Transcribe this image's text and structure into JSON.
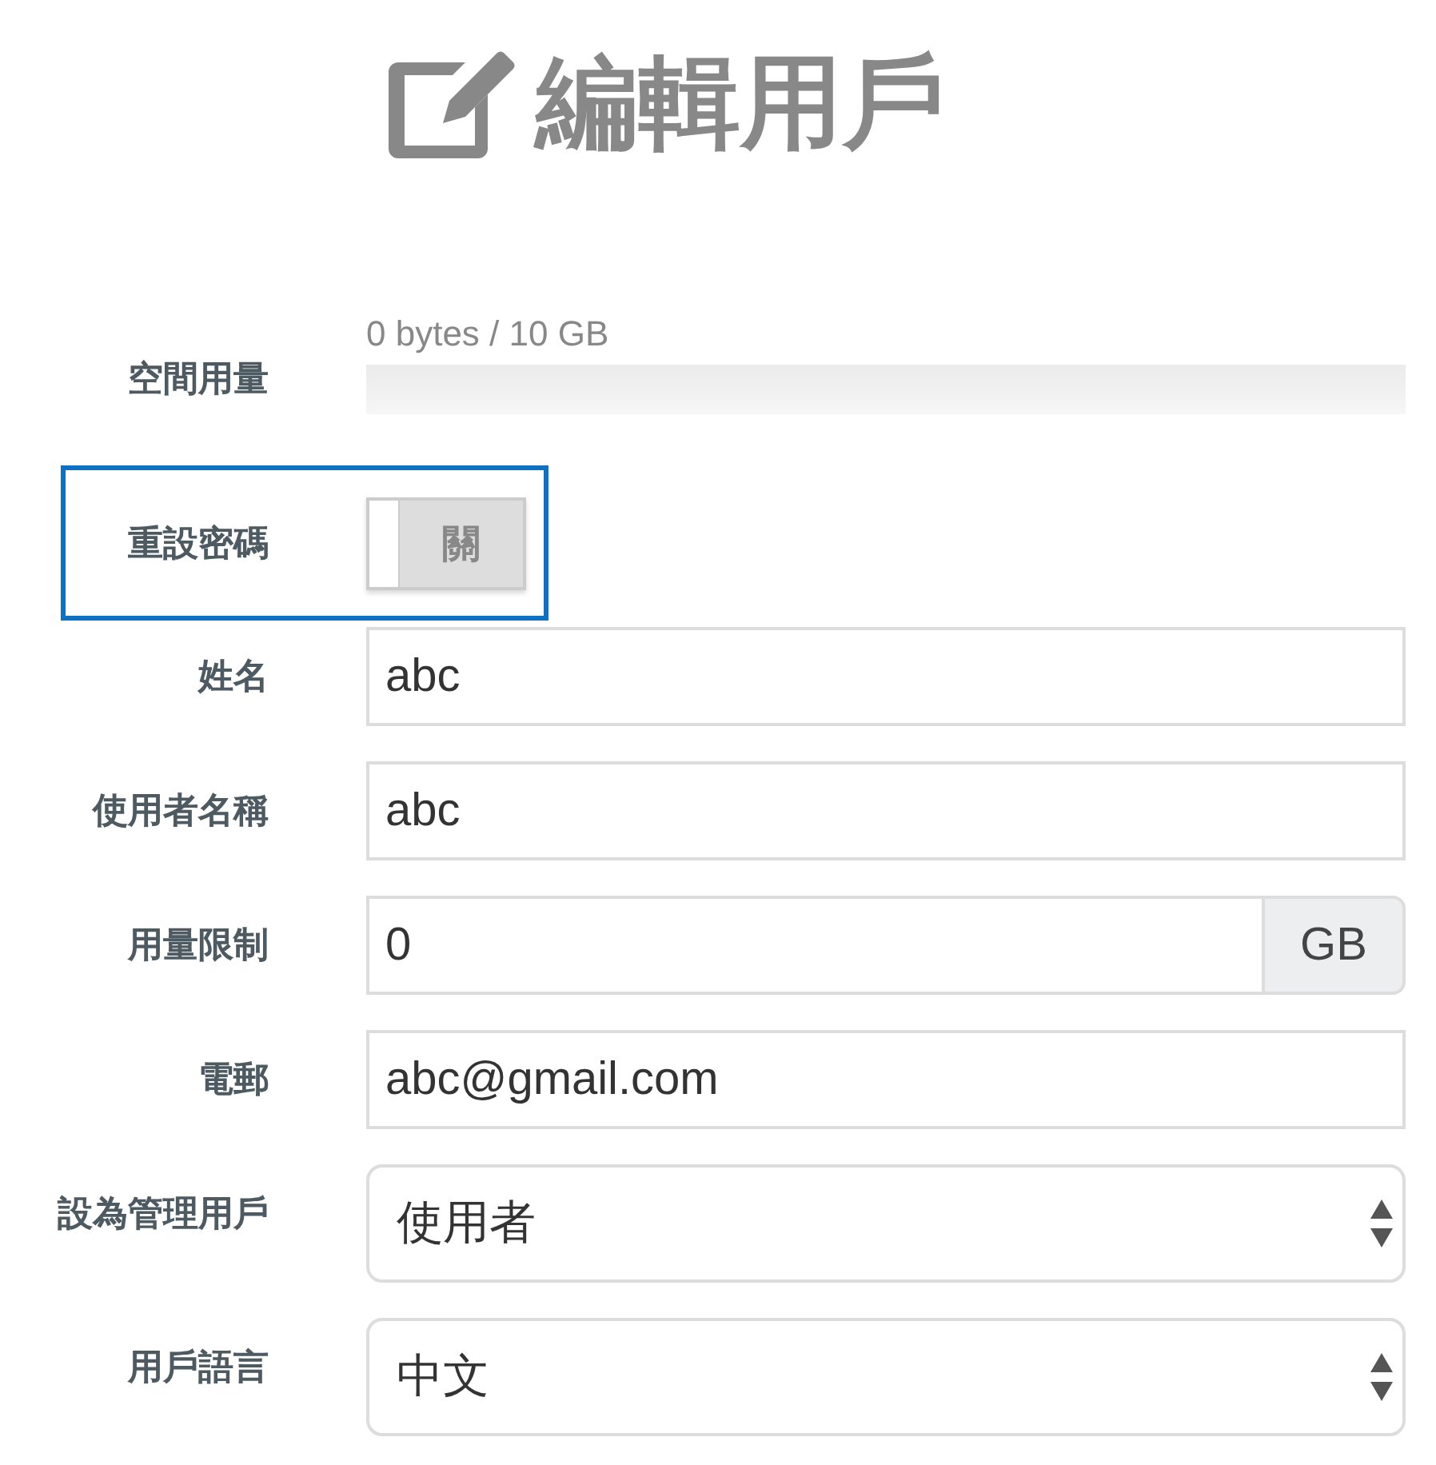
{
  "title": "編輯用戶",
  "storage": {
    "label": "空間用量",
    "reading": "0 bytes / 10 GB",
    "level": 0
  },
  "reset_password": {
    "label": "重設密碼",
    "highlighted": true,
    "toggle": {
      "on": false,
      "off_label": "關"
    }
  },
  "fields": [
    {
      "kind": "text",
      "label": "姓名",
      "value": "abc"
    },
    {
      "kind": "text",
      "label": "使用者名稱",
      "value": "abc"
    },
    {
      "kind": "addon",
      "label": "用量限制",
      "value": "0",
      "addon": "GB"
    },
    {
      "kind": "text",
      "label": "電郵",
      "value": "abc@gmail.com"
    },
    {
      "kind": "select",
      "label": "設為管理用戶",
      "value": "使用者"
    },
    {
      "kind": "select",
      "label": "用戶語言",
      "value": "中文"
    }
  ]
}
